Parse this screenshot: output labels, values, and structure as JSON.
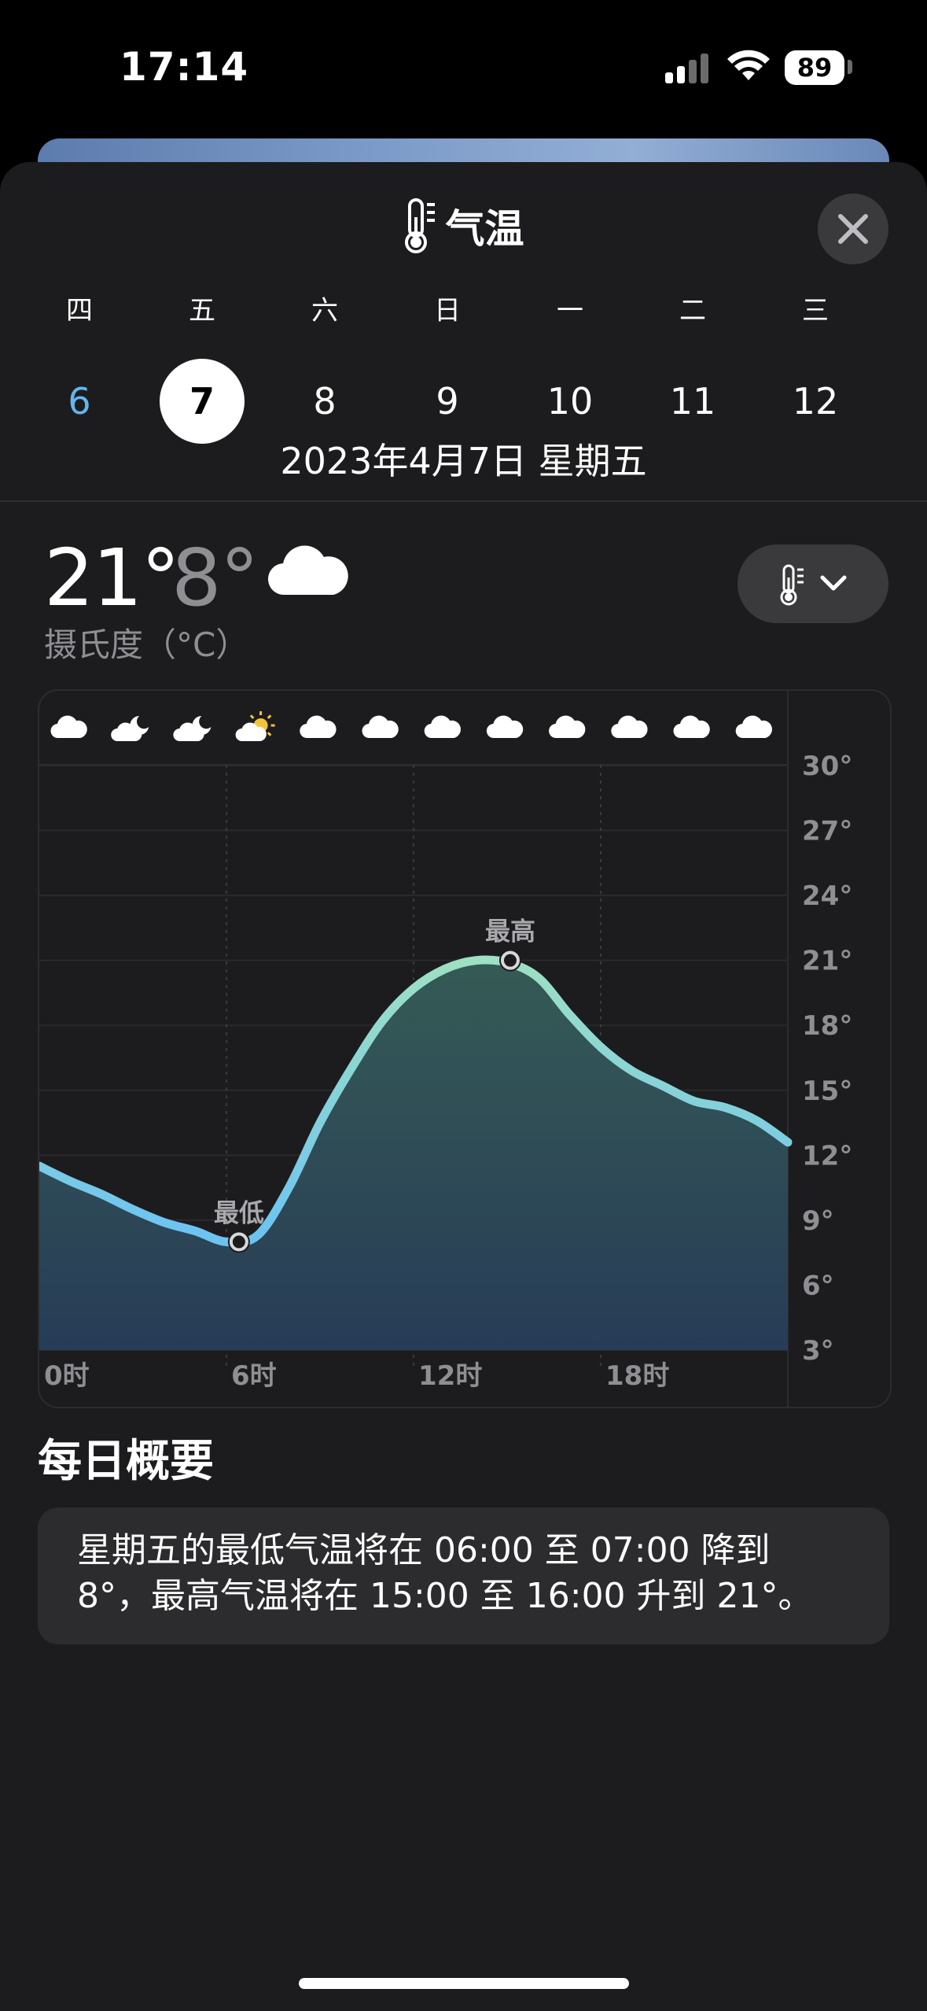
{
  "status_bar": {
    "time": "17:14",
    "battery": "89"
  },
  "sheet": {
    "title": "气温",
    "close_label": "close"
  },
  "calendar": {
    "weekdays": [
      "四",
      "五",
      "六",
      "日",
      "一",
      "二",
      "三"
    ],
    "days": [
      "6",
      "7",
      "8",
      "9",
      "10",
      "11",
      "12"
    ],
    "selected_index": 1,
    "today_index": 0,
    "full_date": "2023年4月7日 星期五"
  },
  "current": {
    "high": "21°",
    "low": "8°",
    "unit": "摄氏度（°C）",
    "condition_icon": "cloud-icon"
  },
  "chart_data": {
    "type": "area",
    "x_labels": [
      "0时",
      "6时",
      "12时",
      "18时"
    ],
    "y_ticks": [
      "30°",
      "27°",
      "24°",
      "21°",
      "18°",
      "15°",
      "12°",
      "9°",
      "6°",
      "3°"
    ],
    "ylim": [
      3,
      30
    ],
    "xlim": [
      0,
      24
    ],
    "x": [
      0,
      1,
      2,
      3,
      4,
      5,
      6,
      7,
      8,
      9,
      10,
      11,
      12,
      13,
      14,
      15,
      16,
      17,
      18,
      19,
      20,
      21,
      22,
      23,
      24
    ],
    "values": [
      11.5,
      10.8,
      10.2,
      9.5,
      8.9,
      8.5,
      8.0,
      8.3,
      10.5,
      13.5,
      16.0,
      18.2,
      19.7,
      20.6,
      21.0,
      20.9,
      20.2,
      18.5,
      17.0,
      15.9,
      15.2,
      14.5,
      14.2,
      13.6,
      12.6
    ],
    "annotations": [
      {
        "label": "最低",
        "x": 6.4,
        "y": 8
      },
      {
        "label": "最高",
        "x": 15.1,
        "y": 21
      }
    ],
    "hourly_icons": [
      "cloud-icon",
      "cloud-moon-icon",
      "cloud-moon-icon",
      "cloud-sun-icon",
      "cloud-icon",
      "cloud-icon",
      "cloud-icon",
      "cloud-icon",
      "cloud-icon",
      "cloud-icon",
      "cloud-icon",
      "cloud-icon"
    ],
    "colors": {
      "low_line": "#6cc3f2",
      "high_line": "#9ee0c3",
      "fill_top": "#355b55",
      "fill_bottom": "#273c57"
    }
  },
  "summary": {
    "title": "每日概要",
    "text_line1": "星期五的最低气温将在 06:00 至 07:00 降到",
    "text_line2": "8°，最高气温将在 15:00 至 16:00 升到 21°。"
  }
}
